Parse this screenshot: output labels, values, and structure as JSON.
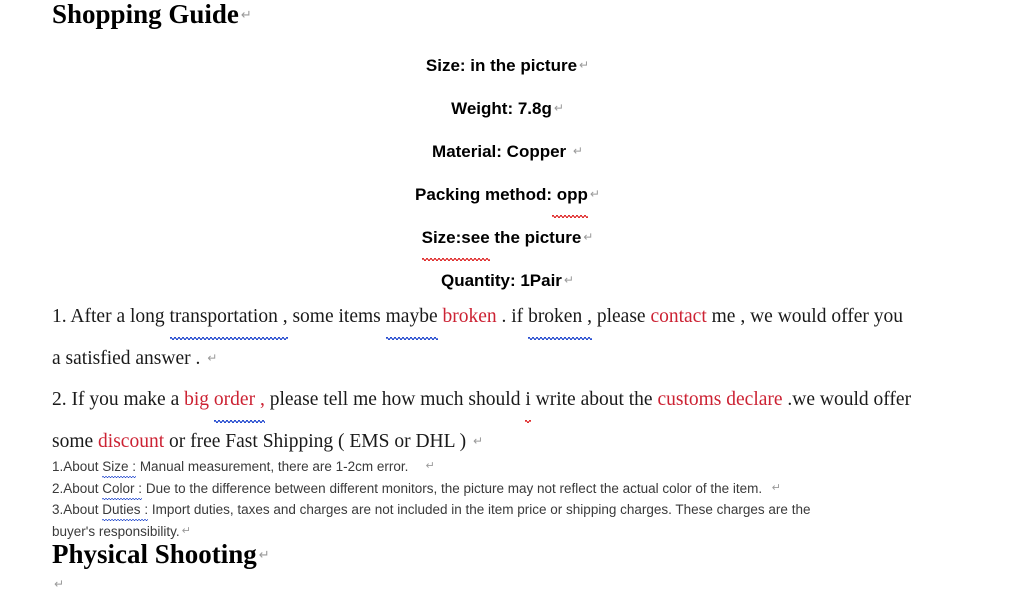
{
  "document": {
    "headings": {
      "shopping_guide": "Shopping Guide",
      "physical_shooting": "Physical Shooting"
    },
    "pilcrow_glyph": "↵",
    "specs": [
      {
        "label": "Size:",
        "value": " in the picture",
        "spell_error": false
      },
      {
        "label": "Weight:",
        "value": " 7.8g",
        "spell_error": false
      },
      {
        "label": "Material:",
        "value": " Copper ",
        "spell_error": false
      },
      {
        "label": "Packing method:",
        "value": " opp",
        "spell_error": true,
        "error_word": "opp"
      },
      {
        "label": "Size:see",
        "value": " the picture",
        "spell_error": true,
        "error_word": "Size:see"
      },
      {
        "label": "Quantity:",
        "value": " 1Pair",
        "spell_error": false
      }
    ],
    "spec_lines_plain": [
      "Size: in the picture",
      "Weight: 7.8g",
      "Material: Copper ",
      "Packing method: opp",
      "Size:see the picture",
      "Quantity: 1Pair"
    ],
    "paragraphs": [
      {
        "id": "paragraph-1",
        "lines": [
          {
            "segments": [
              {
                "text": "1. After a long ",
                "style": "normal"
              },
              {
                "text": "transportation ,",
                "style": "grammar-underline"
              },
              {
                "text": " some items ",
                "style": "normal"
              },
              {
                "text": "maybe",
                "style": "grammar-underline"
              },
              {
                "text": " ",
                "style": "normal"
              },
              {
                "text": "broken",
                "style": "red"
              },
              {
                "text": " . if ",
                "style": "normal"
              },
              {
                "text": "broken ,",
                "style": "grammar-underline"
              },
              {
                "text": " please ",
                "style": "normal"
              },
              {
                "text": "contact",
                "style": "red"
              },
              {
                "text": " me , we would offer you",
                "style": "normal"
              }
            ]
          },
          {
            "segments": [
              {
                "text": "a satisfied answer . ",
                "style": "normal"
              }
            ],
            "pilcrow": true
          }
        ]
      },
      {
        "id": "paragraph-2",
        "lines": [
          {
            "segments": [
              {
                "text": "2. If you make a ",
                "style": "normal"
              },
              {
                "text": "big ",
                "style": "red"
              },
              {
                "text": "order ,",
                "style": "red-grammar-underline"
              },
              {
                "text": " please tell me how much should ",
                "style": "normal"
              },
              {
                "text": "i",
                "style": "spell-underline"
              },
              {
                "text": " write about the ",
                "style": "normal"
              },
              {
                "text": "customs declare",
                "style": "red"
              },
              {
                "text": " .we would offer",
                "style": "normal"
              }
            ]
          },
          {
            "segments": [
              {
                "text": "some ",
                "style": "normal"
              },
              {
                "text": "discount",
                "style": "red"
              },
              {
                "text": " or free Fast Shipping ( EMS or DHL ) ",
                "style": "normal"
              }
            ],
            "pilcrow": true
          }
        ]
      }
    ],
    "notes": [
      {
        "id": "note-size",
        "prefix": "1.About ",
        "term": "Size :",
        "body": " Manual measurement, there are 1-2cm error.    ",
        "pilcrow": true
      },
      {
        "id": "note-color",
        "prefix": "2.About ",
        "term": "Color :",
        "body": " Due to the difference between different monitors, the picture may not reflect the actual color of the item.  ",
        "pilcrow": true
      },
      {
        "id": "note-duties",
        "prefix": "3.About ",
        "term": "Duties :",
        "body": " Import duties, taxes and charges are not included in the item price or shipping charges. These charges are the",
        "pilcrow": false
      },
      {
        "id": "note-duties-cont",
        "prefix": "",
        "term": "",
        "body": "buyer's responsibility.",
        "pilcrow": true
      }
    ],
    "colors": {
      "accent_red": "#cc2233",
      "spell_underline_red": "#e03030",
      "grammar_underline_blue": "#2a4fd0",
      "body_text": "#1a1a1a",
      "note_text": "#3a3a3a",
      "pilcrow_gray": "#9a9a9a",
      "background": "#ffffff"
    }
  }
}
